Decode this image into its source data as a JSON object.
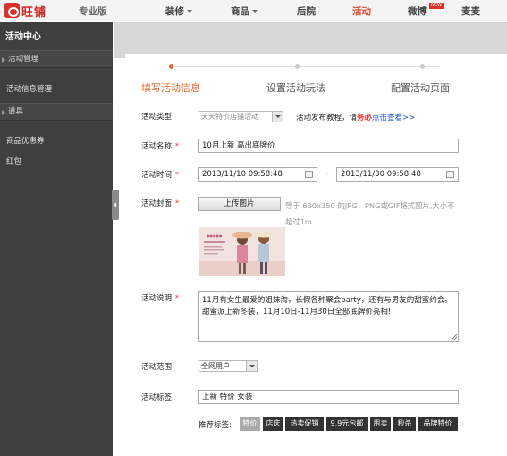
{
  "header": {
    "brand": "旺铺",
    "edition": "专业版",
    "nav": [
      {
        "label": "装修",
        "dropdown": true
      },
      {
        "label": "商品",
        "dropdown": true
      },
      {
        "label": "后院",
        "dropdown": false
      },
      {
        "label": "活动",
        "dropdown": false,
        "active": true
      },
      {
        "label": "微博",
        "dropdown": false,
        "badge": "NEW"
      },
      {
        "label": "麦麦",
        "dropdown": false
      }
    ],
    "accent_color": "#e3412b"
  },
  "sidebar": {
    "title": "活动中心",
    "sections": [
      {
        "label": "活动管理",
        "items": [
          "活动信息管理"
        ]
      },
      {
        "label": "道具",
        "items": [
          "商品优惠券",
          "红包"
        ]
      }
    ]
  },
  "steps": [
    {
      "label": "填写活动信息",
      "active": true
    },
    {
      "label": "设置活动玩法",
      "active": false
    },
    {
      "label": "配置活动页面",
      "active": false
    }
  ],
  "form": {
    "type": {
      "label": "活动类型:",
      "value": "天天特价店铺活动",
      "hint_prefix": "活动发布教程，请",
      "hint_emph": "务必",
      "hint_link": "点击查看>>"
    },
    "name": {
      "label": "活动名称:",
      "value": "10月上新 高出底牌价"
    },
    "time": {
      "label": "活动时间:",
      "start": "2013/11/10 09:58:48",
      "separator": "-",
      "end": "2013/11/30 09:58:48"
    },
    "cover": {
      "label": "活动封面:",
      "upload_label": "上传图片",
      "hint": "等于 630x350 的JPG、PNG或GIF格式图片,大小不超过1m"
    },
    "desc": {
      "label": "活动说明:",
      "value": "11月有女生最爱的姐妹淘，长假各种聚会party，还有与男友的甜蜜约会。甜蜜派上新冬装，11月10日-11月30日全部底牌价亮相!"
    },
    "scope": {
      "label": "活动范围:",
      "value": "全网用户"
    },
    "tags": {
      "label": "活动标签:",
      "value": "上新 特价 女装",
      "recommend_label": "推荐标签:",
      "recommended": [
        "特价",
        "店庆",
        "热卖促销",
        "9.9元包邮",
        "甩卖",
        "秒杀",
        "品牌特价"
      ]
    }
  }
}
